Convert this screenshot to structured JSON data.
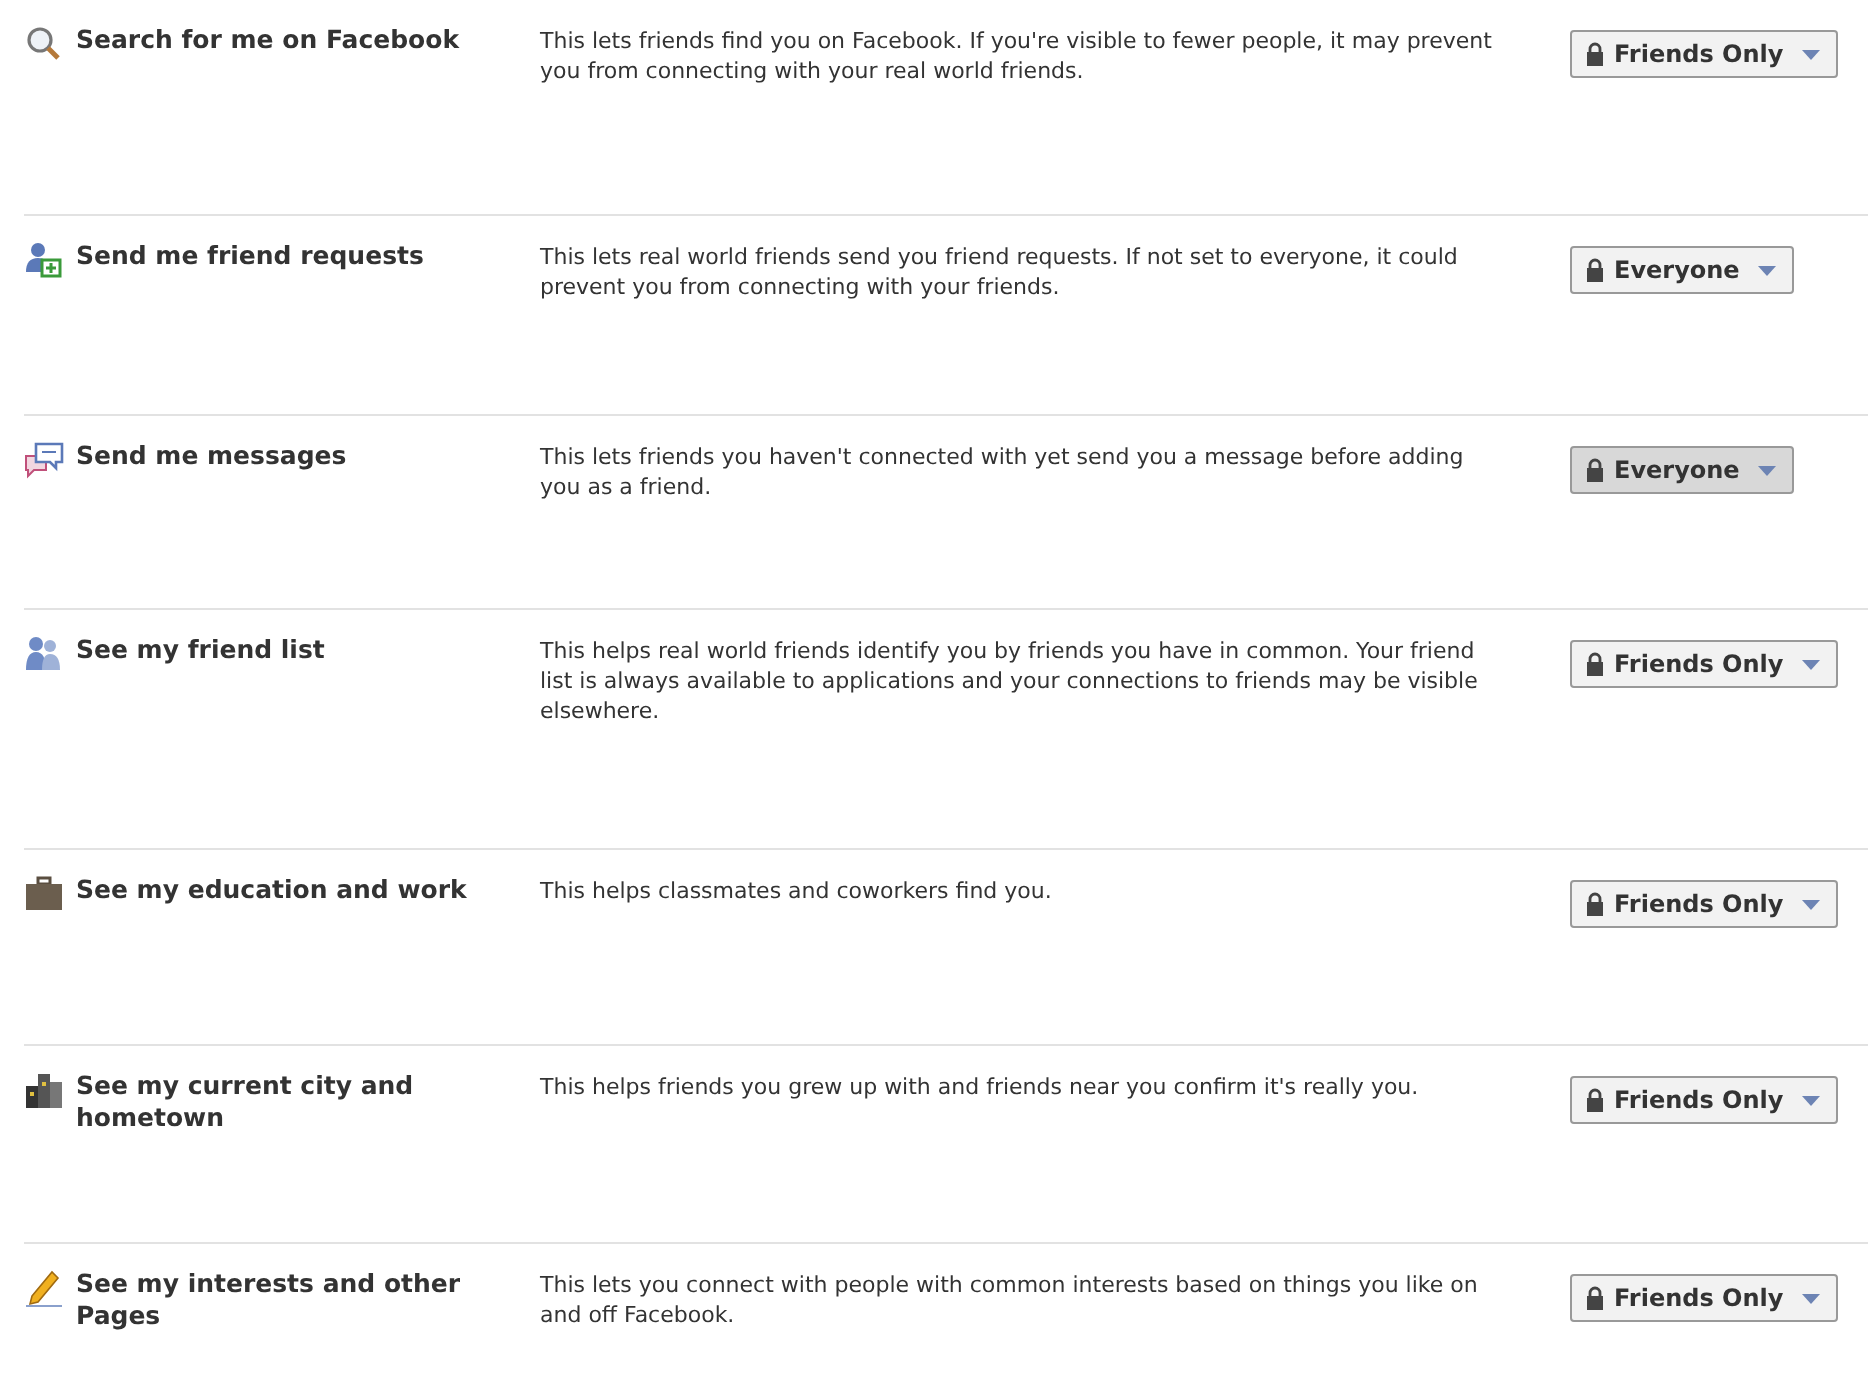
{
  "settings": [
    {
      "title": "Search for me on Facebook",
      "description": "This lets friends find you on Facebook. If you're visible to fewer people, it may prevent you from connecting with your real world friends.",
      "audience": "Friends Only",
      "highlighted": false
    },
    {
      "title": "Send me friend requests",
      "description": "This lets real world friends send you friend requests. If not set to everyone, it could prevent you from connecting with your friends.",
      "audience": "Everyone",
      "highlighted": false
    },
    {
      "title": "Send me messages",
      "description": "This lets friends you haven't connected with yet send you a message before adding you as a friend.",
      "audience": "Everyone",
      "highlighted": true
    },
    {
      "title": "See my friend list",
      "description": "This helps real world friends identify you by friends you have in common. Your friend list is always available to applications and your connections to friends may be visible elsewhere.",
      "audience": "Friends Only",
      "highlighted": false
    },
    {
      "title": "See my education and work",
      "description": "This helps classmates and coworkers find you.",
      "audience": "Friends Only",
      "highlighted": false
    },
    {
      "title": "See my current city and hometown",
      "description": "This helps friends you grew up with and friends near you confirm it's really you.",
      "audience": "Friends Only",
      "highlighted": false
    },
    {
      "title": "See my interests and other Pages",
      "description": "This lets you connect with people with common interests based on things you like on and off Facebook.",
      "audience": "Friends Only",
      "highlighted": false
    }
  ]
}
